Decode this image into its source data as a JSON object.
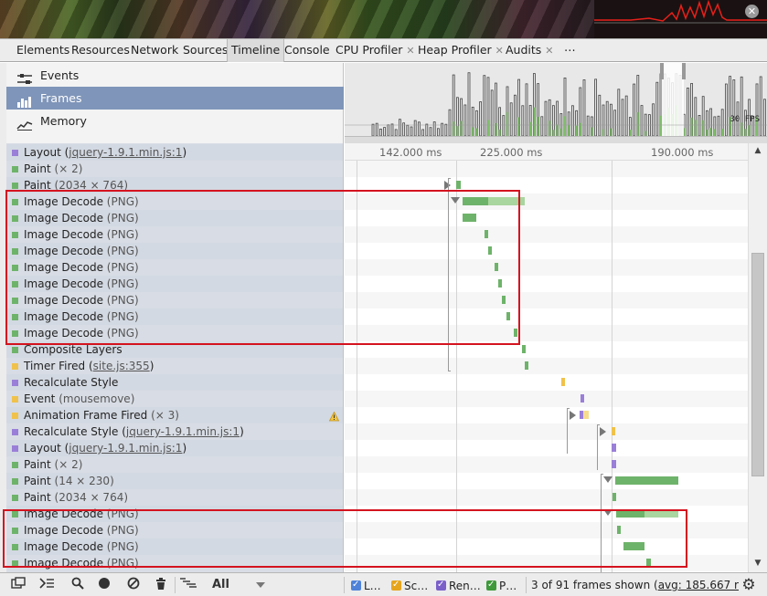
{
  "colors": {
    "loading": "#7f6fd3",
    "scripting": "#f0c24b",
    "rendering": "#9a7fd8",
    "painting": "#6eb36a",
    "selected": "#7f95b9",
    "highlight": "#d4131f"
  },
  "tabs": [
    {
      "label": "Elements",
      "closable": false
    },
    {
      "label": "Resources",
      "closable": false
    },
    {
      "label": "Network",
      "closable": false
    },
    {
      "label": "Sources",
      "closable": false
    },
    {
      "label": "Timeline",
      "closable": false,
      "active": true
    },
    {
      "label": "Console",
      "closable": false
    },
    {
      "label": "CPU Profiler",
      "closable": true
    },
    {
      "label": "Heap Profiler",
      "closable": true
    },
    {
      "label": "Audits",
      "closable": true
    },
    {
      "label": "⋯",
      "closable": false
    }
  ],
  "overview": {
    "items": [
      {
        "label": "Events",
        "icon": "events-icon"
      },
      {
        "label": "Frames",
        "icon": "frames-icon",
        "selected": true
      },
      {
        "label": "Memory",
        "icon": "memory-icon"
      }
    ],
    "fps_label": "30 FPS"
  },
  "timeline": {
    "column_labels": [
      "142.000 ms",
      "225.000 ms",
      "190.000 ms"
    ]
  },
  "records": [
    {
      "type": "Layout",
      "detail": "",
      "link": "jquery-1.9.1.min.js:1",
      "category": "rendering"
    },
    {
      "type": "Paint",
      "detail": "(× 2)",
      "link": "",
      "category": "painting"
    },
    {
      "type": "Paint",
      "detail": "(2034 × 764)",
      "link": "",
      "category": "painting"
    },
    {
      "type": "Image Decode",
      "detail": "(PNG)",
      "link": "",
      "category": "painting"
    },
    {
      "type": "Image Decode",
      "detail": "(PNG)",
      "link": "",
      "category": "painting"
    },
    {
      "type": "Image Decode",
      "detail": "(PNG)",
      "link": "",
      "category": "painting"
    },
    {
      "type": "Image Decode",
      "detail": "(PNG)",
      "link": "",
      "category": "painting"
    },
    {
      "type": "Image Decode",
      "detail": "(PNG)",
      "link": "",
      "category": "painting"
    },
    {
      "type": "Image Decode",
      "detail": "(PNG)",
      "link": "",
      "category": "painting"
    },
    {
      "type": "Image Decode",
      "detail": "(PNG)",
      "link": "",
      "category": "painting"
    },
    {
      "type": "Image Decode",
      "detail": "(PNG)",
      "link": "",
      "category": "painting"
    },
    {
      "type": "Image Decode",
      "detail": "(PNG)",
      "link": "",
      "category": "painting"
    },
    {
      "type": "Composite Layers",
      "detail": "",
      "link": "",
      "category": "painting"
    },
    {
      "type": "Timer Fired",
      "detail": "",
      "link": "site.js:355",
      "category": "scripting"
    },
    {
      "type": "Recalculate Style",
      "detail": "",
      "link": "",
      "category": "rendering"
    },
    {
      "type": "Event",
      "detail": "(mousemove)",
      "link": "",
      "category": "scripting"
    },
    {
      "type": "Animation Frame Fired",
      "detail": "(× 3)",
      "link": "",
      "category": "scripting",
      "warning": true
    },
    {
      "type": "Recalculate Style",
      "detail": "",
      "link": "jquery-1.9.1.min.js:1",
      "category": "rendering"
    },
    {
      "type": "Layout",
      "detail": "",
      "link": "jquery-1.9.1.min.js:1",
      "category": "rendering"
    },
    {
      "type": "Paint",
      "detail": "(× 2)",
      "link": "",
      "category": "painting"
    },
    {
      "type": "Paint",
      "detail": "(14 × 230)",
      "link": "",
      "category": "painting"
    },
    {
      "type": "Paint",
      "detail": "(2034 × 764)",
      "link": "",
      "category": "painting"
    },
    {
      "type": "Image Decode",
      "detail": "(PNG)",
      "link": "",
      "category": "painting"
    },
    {
      "type": "Image Decode",
      "detail": "(PNG)",
      "link": "",
      "category": "painting"
    },
    {
      "type": "Image Decode",
      "detail": "(PNG)",
      "link": "",
      "category": "painting"
    },
    {
      "type": "Image Decode",
      "detail": "(PNG)",
      "link": "",
      "category": "painting"
    }
  ],
  "statusbar": {
    "filter_value": "All",
    "categories": [
      {
        "label": "L…",
        "color": "#4f82d8"
      },
      {
        "label": "Sc…",
        "color": "#e6a51f"
      },
      {
        "label": "Ren…",
        "color": "#7a5fc9"
      },
      {
        "label": "P…",
        "color": "#3e9a3a"
      }
    ],
    "frames_prefix": "3 of 91 frames shown (",
    "frames_avg": "avg: 185.667 r"
  }
}
